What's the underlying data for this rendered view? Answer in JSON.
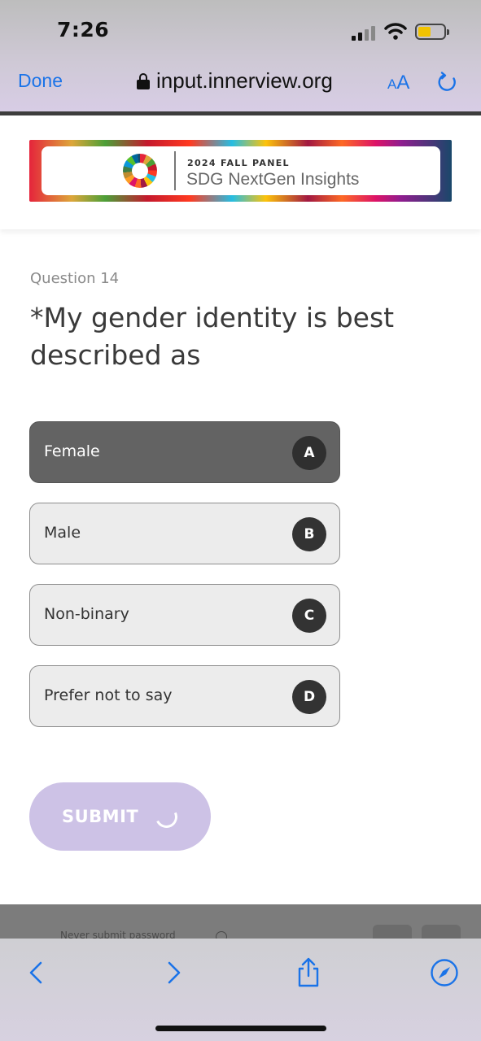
{
  "status_bar": {
    "time": "7:26"
  },
  "safari_top": {
    "done_label": "Done",
    "url": "input.innerview.org",
    "text_size_small": "A",
    "text_size_large": "A"
  },
  "banner": {
    "top_line": "2024 FALL PANEL",
    "title": "SDG NextGen Insights"
  },
  "question": {
    "number_label": "Question 14",
    "text": "*My gender identity is best described as",
    "selected": "A",
    "options": [
      {
        "label": "Female",
        "key": "A"
      },
      {
        "label": "Male",
        "key": "B"
      },
      {
        "label": "Non-binary",
        "key": "C"
      },
      {
        "label": "Prefer not to say",
        "key": "D"
      }
    ]
  },
  "submit": {
    "label": "SUBMIT"
  },
  "password_bar": {
    "text": "Never submit password"
  },
  "colors": {
    "accent_blue": "#1a73e8",
    "selected_option": "#636363",
    "submit_bg": "#cdc2e6"
  },
  "icons": {
    "back": "chevron-left-icon",
    "forward": "chevron-right-icon",
    "share": "share-icon",
    "browser": "compass-icon",
    "reload": "reload-icon",
    "lock": "lock-icon"
  }
}
